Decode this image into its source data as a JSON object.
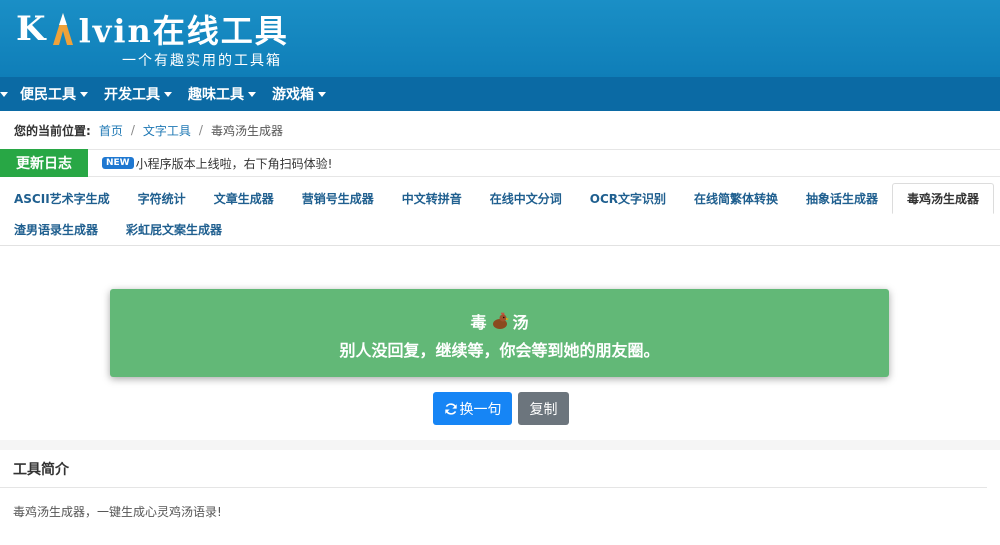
{
  "header": {
    "logo_k": "K",
    "logo_rest": "lvin在线工具",
    "slogan": "一个有趣实用的工具箱"
  },
  "nav": {
    "items": [
      "便民工具",
      "开发工具",
      "趣味工具",
      "游戏箱"
    ]
  },
  "breadcrumb": {
    "label": "您的当前位置:",
    "home": "首页",
    "category": "文字工具",
    "current": "毒鸡汤生成器",
    "separator": "/"
  },
  "changelog": {
    "button": "更新日志",
    "badge": "NEW",
    "text": "小程序版本上线啦，右下角扫码体验!"
  },
  "tabs": {
    "items": [
      "ASCII艺术字生成",
      "字符统计",
      "文章生成器",
      "营销号生成器",
      "中文转拼音",
      "在线中文分词",
      "OCR文字识别",
      "在线简繁体转换",
      "抽象话生成器",
      "毒鸡汤生成器",
      "渣男语录生成器",
      "彩虹屁文案生成器"
    ],
    "active_index": 9
  },
  "soup": {
    "title_left": "毒",
    "title_right": "汤",
    "emoji_icon": "chicken-icon",
    "text": "别人没回复，继续等，你会等到她的朋友圈。"
  },
  "buttons": {
    "change": "换一句",
    "copy": "复制"
  },
  "intro": {
    "title": "工具简介",
    "desc": "毒鸡汤生成器，一键生成心灵鸡汤语录!"
  },
  "colors": {
    "header": "#1a8fc6",
    "navbar": "#0b6aa4",
    "card": "#62b877",
    "primary": "#1685f5",
    "secondary": "#6c757d",
    "changelog": "#28a745"
  }
}
